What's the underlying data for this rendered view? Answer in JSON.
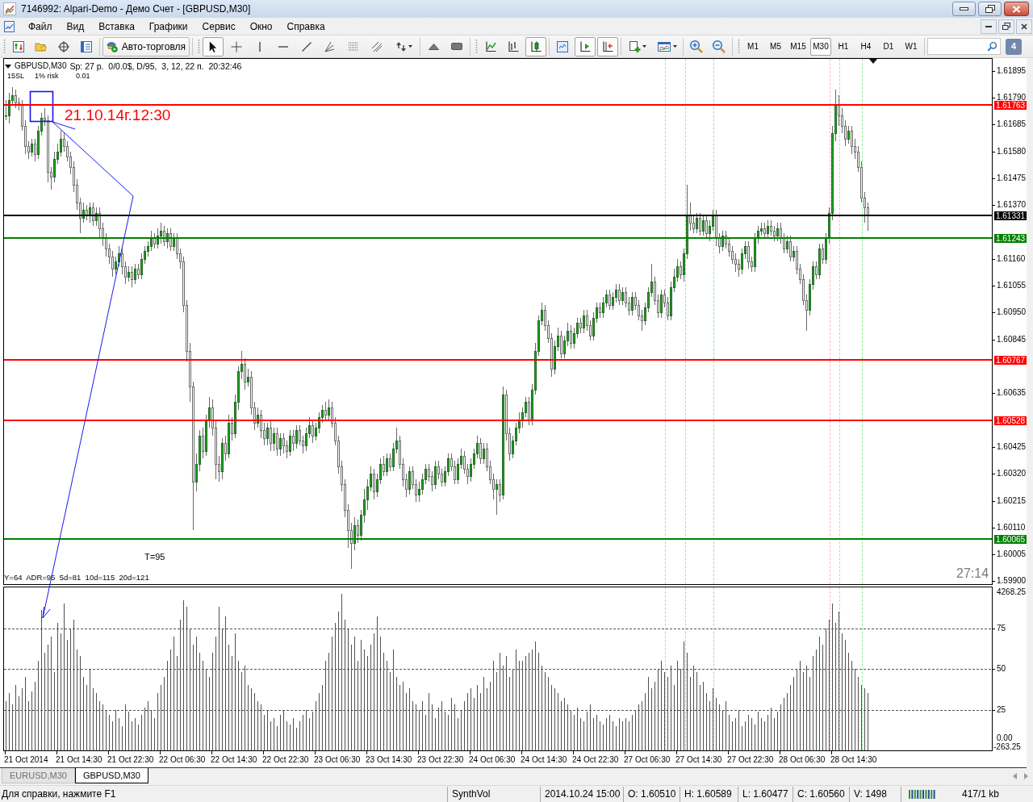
{
  "window": {
    "title": "7146992: Alpari-Demo - Демо Счет - [GBPUSD,M30]"
  },
  "menu": [
    "Файл",
    "Вид",
    "Вставка",
    "Графики",
    "Сервис",
    "Окно",
    "Справка"
  ],
  "toolbar": {
    "autotrading": "Авто-торговля",
    "drawing_tools": [
      {
        "selected": true
      },
      {
        "selected": false
      },
      {
        "selected": false
      },
      {
        "selected": false
      },
      {
        "selected": false
      },
      {
        "selected": false
      },
      {
        "selected": false
      },
      {
        "selected": false
      },
      {
        "selected": false
      }
    ],
    "chart_types": [
      {
        "selected": false
      },
      {
        "selected": false
      },
      {
        "selected": true
      }
    ],
    "auto_scroll": {
      "on": true
    },
    "chart_shift": {
      "on": true
    },
    "timeframes": [
      {
        "label": "M1",
        "selected": false
      },
      {
        "label": "M5",
        "selected": false
      },
      {
        "label": "M15",
        "selected": false
      },
      {
        "label": "M30",
        "selected": true
      },
      {
        "label": "H1",
        "selected": false
      },
      {
        "label": "H4",
        "selected": false
      },
      {
        "label": "D1",
        "selected": false
      },
      {
        "label": "W1",
        "selected": false
      }
    ],
    "messages": "4"
  },
  "chart": {
    "symbol": "GBPUSD,M30",
    "spread_info": "Sp: 27 p.  0/0.0$, D/95,  3, 12, 22 п.  20:32:46",
    "risk_info": [
      "15SL",
      "1% risk",
      "0.01"
    ],
    "note": "21.10.14г.12:30",
    "range_label": "T=95",
    "stats": "Y=64  ADR=95  5d=81  10d=115  20d=121",
    "countdown": "27:14",
    "price_axis": [
      "1.61895",
      "1.61790",
      "1.61685",
      "1.61580",
      "1.61475",
      "1.61370",
      "1.61160",
      "1.61055",
      "1.60950",
      "1.60845",
      "1.60635",
      "1.60425",
      "1.60320",
      "1.60215",
      "1.60110",
      "1.60005",
      "1.59900"
    ],
    "price_levels": [
      {
        "label": "1.61763",
        "color": "#ff0000"
      },
      {
        "label": "1.61331",
        "color": "#000000"
      },
      {
        "label": "1.61243",
        "color": "#008000"
      },
      {
        "label": "1.60767",
        "color": "#ff0000"
      },
      {
        "label": "1.60528",
        "color": "#ff0000"
      },
      {
        "label": "1.60065",
        "color": "#008000"
      }
    ],
    "time_markers": [
      {
        "color": "#90ee90"
      },
      {
        "color": "#90ee90"
      },
      {
        "color": "#90ee90"
      },
      {
        "color": "#ffb6c1"
      },
      {
        "color": "#ffb6c1"
      },
      {
        "color": "#90ee90"
      }
    ],
    "time_axis": [
      "21 Oct 2014",
      "21 Oct 14:30",
      "21 Oct 22:30",
      "22 Oct 06:30",
      "22 Oct 14:30",
      "22 Oct 22:30",
      "23 Oct 06:30",
      "23 Oct 14:30",
      "23 Oct 22:30",
      "24 Oct 06:30",
      "24 Oct 14:30",
      "24 Oct 22:30",
      "27 Oct 06:30",
      "27 Oct 14:30",
      "27 Oct 22:30",
      "28 Oct 06:30",
      "28 Oct 14:30"
    ]
  },
  "indicator": {
    "scale_max": "4268.25",
    "zero_label": "0.00",
    "scale_min": "-263.25",
    "chart_data": {
      "type": "bar",
      "series": [
        {
          "values": [
            30,
            35,
            28,
            40,
            33,
            38,
            45,
            30,
            36,
            42,
            55,
            86,
            60,
            65,
            70,
            48,
            78,
            72,
            90,
            68,
            75,
            80,
            62,
            58,
            45,
            40,
            50,
            38,
            35,
            30,
            28,
            25,
            22,
            18,
            25,
            20,
            15,
            28,
            24,
            18,
            20,
            16,
            22,
            26,
            30,
            25,
            20,
            35,
            40,
            45,
            55,
            62,
            70,
            58,
            80,
            92,
            88,
            75,
            65,
            70,
            60,
            55,
            50,
            45,
            60,
            70,
            88,
            75,
            82,
            65,
            58,
            72,
            55,
            48,
            52,
            40,
            38,
            35,
            30,
            28,
            22,
            25,
            18,
            20,
            15,
            22,
            25,
            18,
            16,
            20,
            14,
            18,
            22,
            25,
            20,
            24,
            30,
            35,
            40,
            55,
            60,
            70,
            78,
            85,
            96,
            80,
            75,
            65,
            70,
            55,
            68,
            62,
            58,
            65,
            72,
            82,
            70,
            60,
            55,
            48,
            62,
            45,
            40,
            42,
            35,
            38,
            30,
            28,
            25,
            30,
            22,
            35,
            28,
            20,
            26,
            30,
            24,
            22,
            32,
            28,
            20,
            25,
            30,
            35,
            38,
            32,
            40,
            35,
            45,
            38,
            42,
            55,
            48,
            60,
            52,
            58,
            45,
            50,
            62,
            55,
            55,
            58,
            60,
            62,
            67,
            60,
            52,
            48,
            45,
            40,
            38,
            35,
            30,
            32,
            28,
            25,
            22,
            26,
            20,
            18,
            24,
            28,
            20,
            22,
            18,
            16,
            20,
            22,
            18,
            15,
            20,
            18,
            20,
            18,
            22,
            25,
            28,
            30,
            35,
            45,
            38,
            42,
            50,
            55,
            48,
            45,
            52,
            40,
            55,
            50,
            67,
            60,
            45,
            52,
            48,
            40,
            42,
            35,
            30,
            38,
            32,
            28,
            25,
            30,
            22,
            18,
            20,
            25,
            15,
            18,
            22,
            20,
            16,
            24,
            20,
            18,
            22,
            26,
            20,
            24,
            28,
            32,
            35,
            40,
            45,
            50,
            55,
            48,
            52,
            45,
            58,
            62,
            70,
            65,
            75,
            80,
            90,
            78,
            85,
            72,
            68,
            60,
            55,
            50,
            45,
            40,
            38,
            35,
            null,
            null,
            null,
            null,
            null,
            null,
            null,
            null,
            null,
            null,
            null,
            null,
            null,
            null,
            null,
            null,
            null,
            null,
            null,
            null,
            null,
            null,
            null,
            null,
            null,
            null,
            null,
            null,
            null,
            null,
            null,
            null,
            null,
            null,
            null,
            null,
            null,
            null
          ]
        }
      ],
      "ylim": [
        0,
        100
      ],
      "yticks": [
        {
          "value": 75,
          "label": "75"
        },
        {
          "value": 50,
          "label": "50"
        },
        {
          "value": 25,
          "label": "25"
        }
      ],
      "grid": true
    }
  },
  "tabs": [
    {
      "label": "EURUSD,M30",
      "selected": false
    },
    {
      "label": "GBPUSD,M30",
      "selected": true
    }
  ],
  "status_bar": {
    "help": "Для справки, нажмите F1",
    "indicator": "SynthVol",
    "time": "2014.10.24 15:00",
    "open": "O: 1.60510",
    "high": "H: 1.60589",
    "low": "L: 1.60477",
    "close": "C: 1.60560",
    "volume": "V: 1498",
    "traffic": "417/1 kb"
  }
}
